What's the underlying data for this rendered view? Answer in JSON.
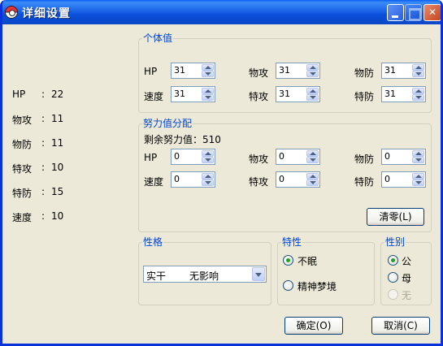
{
  "window": {
    "title": "详细设置"
  },
  "stats": [
    {
      "label": "HP",
      "colon": ":",
      "value": "22"
    },
    {
      "label": "物攻",
      "colon": ":",
      "value": "11"
    },
    {
      "label": "物防",
      "colon": ":",
      "value": "11"
    },
    {
      "label": "特攻",
      "colon": ":",
      "value": "10"
    },
    {
      "label": "特防",
      "colon": ":",
      "value": "15"
    },
    {
      "label": "速度",
      "colon": ":",
      "value": "10"
    }
  ],
  "iv": {
    "title": "个体值",
    "labels": [
      "HP",
      "物攻",
      "物防",
      "速度",
      "特攻",
      "特防"
    ],
    "values": [
      "31",
      "31",
      "31",
      "31",
      "31",
      "31"
    ]
  },
  "ev": {
    "title": "努力值分配",
    "remaining": "剩余努力值：510",
    "labels": [
      "HP",
      "物攻",
      "物防",
      "速度",
      "特攻",
      "特防"
    ],
    "values": [
      "0",
      "0",
      "0",
      "0",
      "0",
      "0"
    ],
    "clear_label": "清零(L)"
  },
  "nature": {
    "title": "性格",
    "value": "实干",
    "effect": "无影响"
  },
  "ability": {
    "title": "特性",
    "options": [
      "不眠",
      "精神梦境"
    ],
    "selected_index": 0
  },
  "gender": {
    "title": "性别",
    "options": [
      "公",
      "母",
      "无"
    ],
    "selected_index": 0
  },
  "buttons": {
    "ok": "确定(O)",
    "cancel": "取消(C)"
  }
}
